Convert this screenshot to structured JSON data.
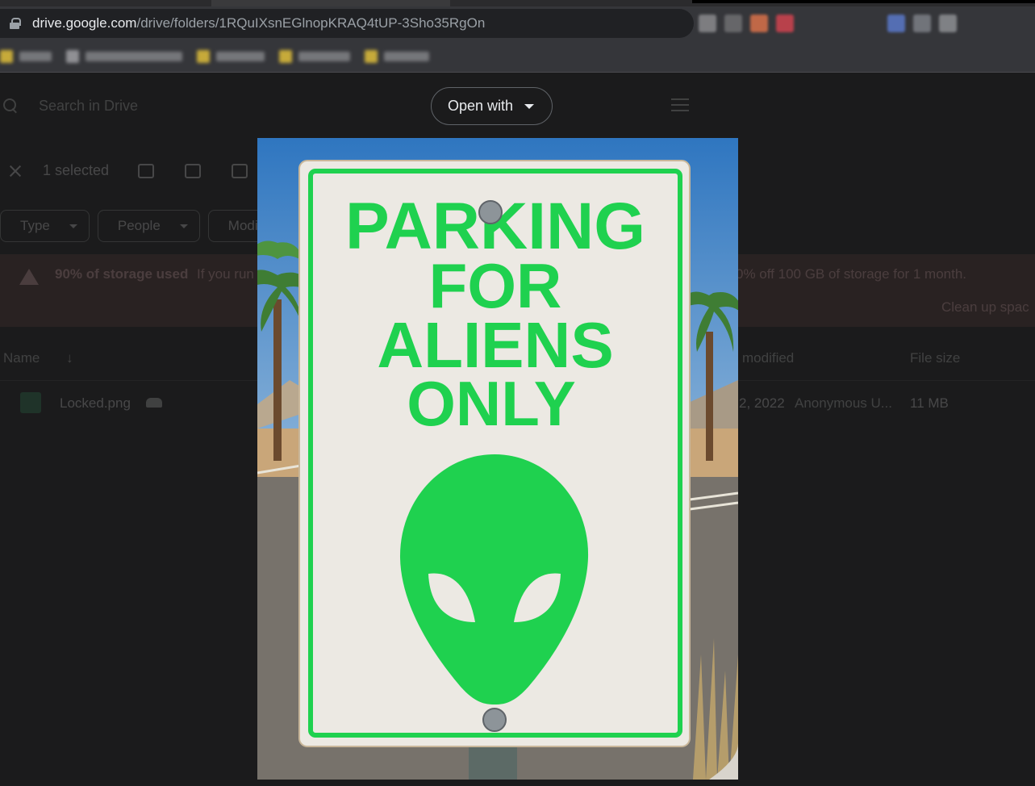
{
  "browser": {
    "url_host": "drive.google.com",
    "url_path": "/drive/folders/1RQuIXsnEGlnopKRAQ4tUP-3Sho35RgOn",
    "lock_icon": "lock-icon"
  },
  "drive": {
    "search_placeholder": "Search in Drive",
    "selection_text": "1 selected",
    "filters": [
      "Type",
      "People",
      "Modi"
    ],
    "storage_banner": {
      "bold": "90% of storage used",
      "text": "If you run",
      "text_right": "0% off 100 GB of storage for 1 month.",
      "cleanup": "Clean up spac"
    },
    "table": {
      "col_name": "Name",
      "col_modified": "modified",
      "col_size": "File size",
      "file_name": "Locked.png",
      "file_date": "2, 2022",
      "file_owner": "Anonymous U...",
      "file_size": "11 MB"
    }
  },
  "preview": {
    "open_with_label": "Open with",
    "sign_line1": "PARKING",
    "sign_line2": "FOR",
    "sign_line3": "ALIENS",
    "sign_line4": "ONLY",
    "sign_color": "#1fd14f",
    "sky_color": "#3d7fc4"
  }
}
